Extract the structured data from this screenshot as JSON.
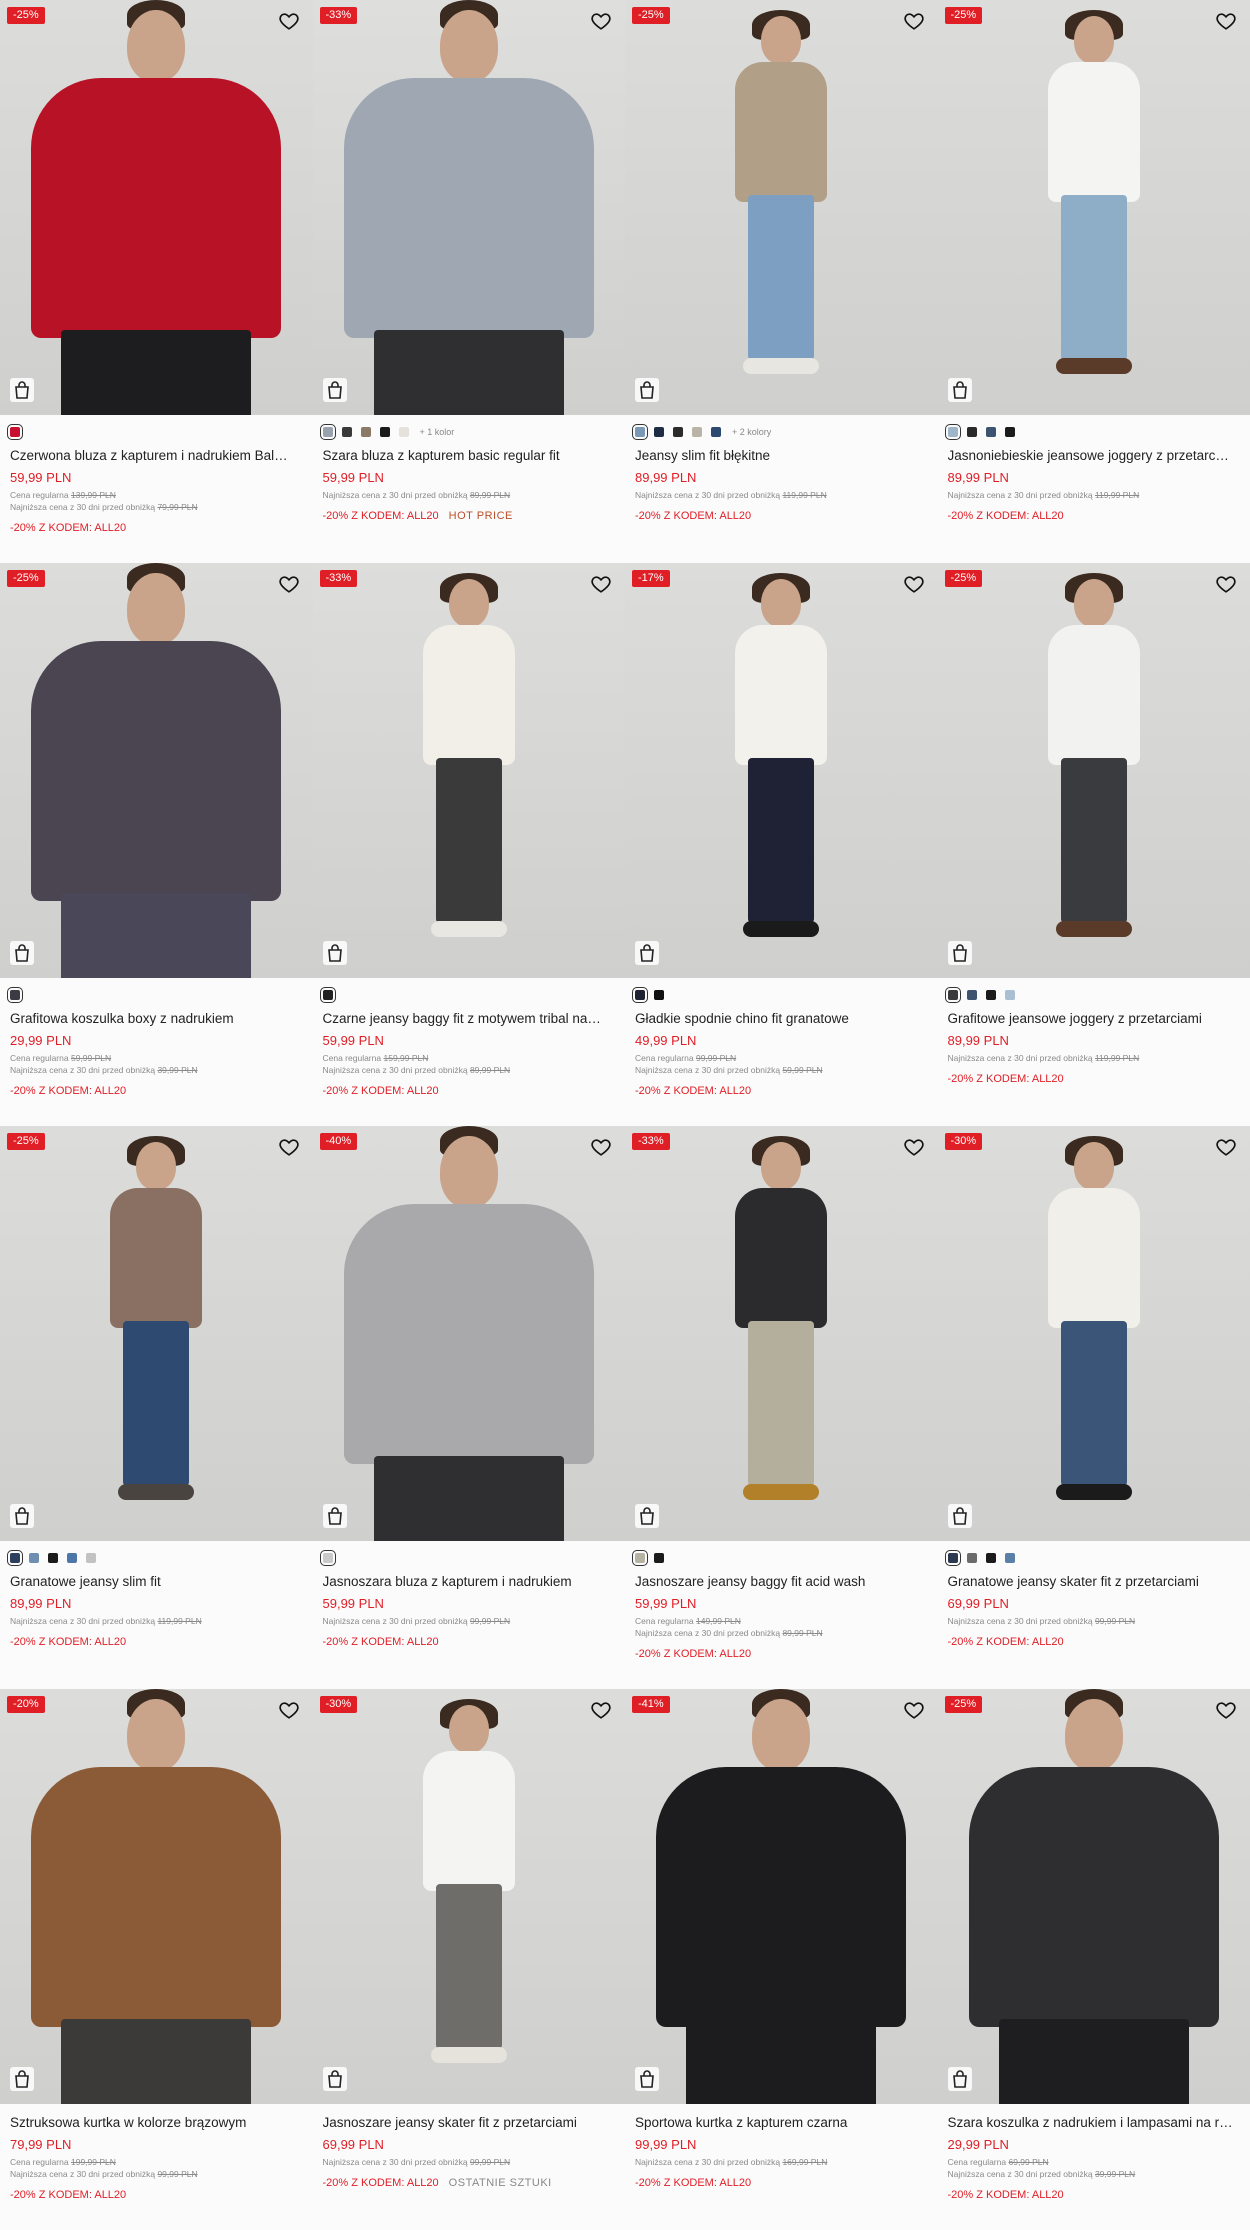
{
  "products": [
    {
      "discount": "-25%",
      "name": "Czerwona bluza z kapturem i nadrukiem Bal…",
      "price": "59,99 PLN",
      "regular_label": "Cena regularna",
      "regular_price": "139,99 PLN",
      "lowest_label": "Najniższa cena z 30 dni przed obniżką",
      "lowest_price": "79,99 PLN",
      "promo": "-20% Z KODEM: ALL20",
      "tag": "",
      "extra_colors": "",
      "swatches": [
        "#c8102e"
      ],
      "colors": {
        "bg": "#dcdcdb",
        "top": "#b81226",
        "bottom": "#1d1d1f",
        "shoes": "#1d1d1f"
      }
    },
    {
      "discount": "-33%",
      "name": "Szara bluza z kapturem basic regular fit",
      "price": "59,99 PLN",
      "regular_label": "",
      "regular_price": "",
      "lowest_label": "Najniższa cena z 30 dni przed obniżką",
      "lowest_price": "89,99 PLN",
      "promo": "-20% Z KODEM: ALL20",
      "tag": "HOT PRICE",
      "extra_colors": "+ 1 kolor",
      "swatches": [
        "#9aa3ad",
        "#3a3a3a",
        "#8c7a68",
        "#1b1b1b",
        "#e5e2dc"
      ],
      "colors": {
        "bg": "#dededd",
        "top": "#9fa8b2",
        "bottom": "#2f2f31",
        "shoes": "#2a2a2a"
      }
    },
    {
      "discount": "-25%",
      "name": "Jeansy slim fit błękitne",
      "price": "89,99 PLN",
      "regular_label": "",
      "regular_price": "",
      "lowest_label": "Najniższa cena z 30 dni przed obniżką",
      "lowest_price": "119,99 PLN",
      "promo": "-20% Z KODEM: ALL20",
      "tag": "",
      "extra_colors": "+ 2 kolory",
      "swatches": [
        "#7b98b5",
        "#1f2d44",
        "#2b2b2b",
        "#b9b3a8",
        "#2c4a70"
      ],
      "colors": {
        "bg": "#dcdcdb",
        "top": "#b19f88",
        "bottom": "#7d9fc1",
        "shoes": "#e8e6e1"
      }
    },
    {
      "discount": "-25%",
      "name": "Jasnoniebieskie jeansowe joggery z przetarc…",
      "price": "89,99 PLN",
      "regular_label": "",
      "regular_price": "",
      "lowest_label": "Najniższa cena z 30 dni przed obniżką",
      "lowest_price": "119,99 PLN",
      "promo": "-20% Z KODEM: ALL20",
      "tag": "",
      "extra_colors": "",
      "swatches": [
        "#9fb6c9",
        "#2a2a2a",
        "#3c5470",
        "#1b1b1b"
      ],
      "colors": {
        "bg": "#dcdcdb",
        "top": "#f4f4f2",
        "bottom": "#8eadc7",
        "shoes": "#5a3a28"
      }
    },
    {
      "discount": "-25%",
      "name": "Grafitowa koszulka boxy z nadrukiem",
      "price": "29,99 PLN",
      "regular_label": "Cena regularna",
      "regular_price": "59,99 PLN",
      "lowest_label": "Najniższa cena z 30 dni przed obniżką",
      "lowest_price": "39,99 PLN",
      "promo": "-20% Z KODEM: ALL20",
      "tag": "",
      "extra_colors": "",
      "swatches": [
        "#3c3a42"
      ],
      "colors": {
        "bg": "#dcdcdb",
        "top": "#4a4550",
        "bottom": "#4a4858",
        "shoes": "#2a2a2a"
      }
    },
    {
      "discount": "-33%",
      "name": "Czarne jeansy baggy fit z motywem tribal na…",
      "price": "59,99 PLN",
      "regular_label": "Cena regularna",
      "regular_price": "159,99 PLN",
      "lowest_label": "Najniższa cena z 30 dni przed obniżką",
      "lowest_price": "89,99 PLN",
      "promo": "-20% Z KODEM: ALL20",
      "tag": "",
      "extra_colors": "",
      "swatches": [
        "#222222"
      ],
      "colors": {
        "bg": "#dddddc",
        "top": "#f1efe8",
        "bottom": "#3a3a3b",
        "shoes": "#e9e7e2"
      }
    },
    {
      "discount": "-17%",
      "name": "Gładkie spodnie chino fit granatowe",
      "price": "49,99 PLN",
      "regular_label": "Cena regularna",
      "regular_price": "99,99 PLN",
      "lowest_label": "Najniższa cena z 30 dni przed obniżką",
      "lowest_price": "59,99 PLN",
      "promo": "-20% Z KODEM: ALL20",
      "tag": "",
      "extra_colors": "",
      "swatches": [
        "#1e2233",
        "#111111"
      ],
      "colors": {
        "bg": "#dcdcdb",
        "top": "#f3f1ec",
        "bottom": "#1f2234",
        "shoes": "#1a1a1a"
      }
    },
    {
      "discount": "-25%",
      "name": "Grafitowe jeansowe joggery z przetarciami",
      "price": "89,99 PLN",
      "regular_label": "",
      "regular_price": "",
      "lowest_label": "Najniższa cena z 30 dni przed obniżką",
      "lowest_price": "119,99 PLN",
      "promo": "-20% Z KODEM: ALL20",
      "tag": "",
      "extra_colors": "",
      "swatches": [
        "#3a3a3c",
        "#3c5470",
        "#1b1b1b",
        "#a8bfd4"
      ],
      "colors": {
        "bg": "#dcdcdb",
        "top": "#f2f2f0",
        "bottom": "#3a3b3e",
        "shoes": "#5a3a28"
      }
    },
    {
      "discount": "-25%",
      "name": "Granatowe jeansy slim fit",
      "price": "89,99 PLN",
      "regular_label": "",
      "regular_price": "",
      "lowest_label": "Najniższa cena z 30 dni przed obniżką",
      "lowest_price": "119,99 PLN",
      "promo": "-20% Z KODEM: ALL20",
      "tag": "",
      "extra_colors": "",
      "swatches": [
        "#2c3f5c",
        "#6f8fb0",
        "#1b1b1b",
        "#4d77a8",
        "#c2c2c2"
      ],
      "colors": {
        "bg": "#dcdcdb",
        "top": "#8a6f63",
        "bottom": "#2f4a70",
        "shoes": "#4a4440"
      }
    },
    {
      "discount": "-40%",
      "name": "Jasnoszara bluza z kapturem i nadrukiem",
      "price": "59,99 PLN",
      "regular_label": "",
      "regular_price": "",
      "lowest_label": "Najniższa cena z 30 dni przed obniżką",
      "lowest_price": "99,99 PLN",
      "promo": "-20% Z KODEM: ALL20",
      "tag": "",
      "extra_colors": "",
      "swatches": [
        "#c9c9c9"
      ],
      "colors": {
        "bg": "#dcdcdb",
        "top": "#a9a9ab",
        "bottom": "#2f2f31",
        "shoes": "#2a2a2a"
      }
    },
    {
      "discount": "-33%",
      "name": "Jasnoszare jeansy baggy fit acid wash",
      "price": "59,99 PLN",
      "regular_label": "Cena regularna",
      "regular_price": "149,99 PLN",
      "lowest_label": "Najniższa cena z 30 dni przed obniżką",
      "lowest_price": "89,99 PLN",
      "promo": "-20% Z KODEM: ALL20",
      "tag": "",
      "extra_colors": "",
      "swatches": [
        "#b7b3a4",
        "#1b1b1b"
      ],
      "colors": {
        "bg": "#dcdcdb",
        "top": "#2b2a2d",
        "bottom": "#b4ae9c",
        "shoes": "#b3802a"
      }
    },
    {
      "discount": "-30%",
      "name": "Granatowe jeansy skater fit z przetarciami",
      "price": "69,99 PLN",
      "regular_label": "",
      "regular_price": "",
      "lowest_label": "Najniższa cena z 30 dni przed obniżką",
      "lowest_price": "99,99 PLN",
      "promo": "-20% Z KODEM: ALL20",
      "tag": "",
      "extra_colors": "",
      "swatches": [
        "#2a3950",
        "#6b6b6b",
        "#1b1b1b",
        "#5b80a8"
      ],
      "colors": {
        "bg": "#dcdcdb",
        "top": "#f1efe9",
        "bottom": "#3b5578",
        "shoes": "#1b1b1b"
      }
    },
    {
      "discount": "-20%",
      "name": "Sztruksowa kurtka w kolorze brązowym",
      "price": "79,99 PLN",
      "regular_label": "Cena regularna",
      "regular_price": "199,99 PLN",
      "lowest_label": "Najniższa cena z 30 dni przed obniżką",
      "lowest_price": "99,99 PLN",
      "promo": "-20% Z KODEM: ALL20",
      "tag": "",
      "extra_colors": "",
      "swatches": [],
      "colors": {
        "bg": "#dcdcdb",
        "top": "#8b5a36",
        "bottom": "#3b3a38",
        "shoes": "#2a2a2a"
      }
    },
    {
      "discount": "-30%",
      "name": "Jasnoszare jeansy skater fit z przetarciami",
      "price": "69,99 PLN",
      "regular_label": "",
      "regular_price": "",
      "lowest_label": "Najniższa cena z 30 dni przed obniżką",
      "lowest_price": "99,99 PLN",
      "promo": "-20% Z KODEM: ALL20",
      "tag": "OSTATNIE SZTUKI",
      "extra_colors": "",
      "swatches": [],
      "colors": {
        "bg": "#dcdcdb",
        "top": "#f4f4f2",
        "bottom": "#6f6d6a",
        "shoes": "#e6e3dc"
      }
    },
    {
      "discount": "-41%",
      "name": "Sportowa kurtka z kapturem czarna",
      "price": "99,99 PLN",
      "regular_label": "",
      "regular_price": "",
      "lowest_label": "Najniższa cena z 30 dni przed obniżką",
      "lowest_price": "169,99 PLN",
      "promo": "-20% Z KODEM: ALL20",
      "tag": "",
      "extra_colors": "",
      "swatches": [],
      "colors": {
        "bg": "#dcdcdb",
        "top": "#1c1c1e",
        "bottom": "#1c1c1e",
        "shoes": "#1c1c1e"
      }
    },
    {
      "discount": "-25%",
      "name": "Szara koszulka z nadrukiem i lampasami na r…",
      "price": "29,99 PLN",
      "regular_label": "Cena regularna",
      "regular_price": "69,99 PLN",
      "lowest_label": "Najniższa cena z 30 dni przed obniżką",
      "lowest_price": "39,99 PLN",
      "promo": "-20% Z KODEM: ALL20",
      "tag": "",
      "extra_colors": "",
      "swatches": [],
      "colors": {
        "bg": "#dcdcdb",
        "top": "#2e2e30",
        "bottom": "#1e1e20",
        "shoes": "#1e1e20"
      }
    }
  ],
  "accent": "#e01e26",
  "icons": {
    "wishlist": "heart-icon",
    "cart": "shopping-bag-icon"
  }
}
